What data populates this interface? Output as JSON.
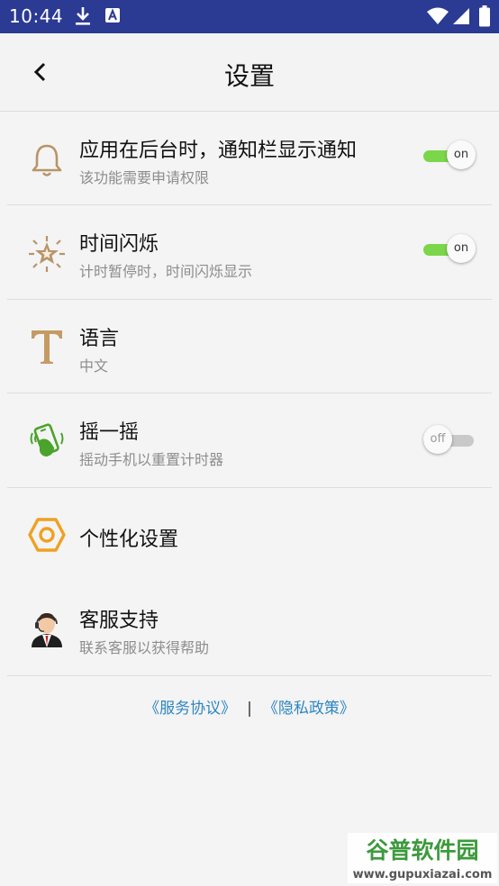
{
  "status_bar": {
    "time": "10:44",
    "icons": [
      "download-icon",
      "text-a-icon",
      "wifi-icon",
      "signal-icon",
      "battery-icon"
    ]
  },
  "header": {
    "title": "设置",
    "back_icon": "chevron-left-icon"
  },
  "settings": [
    {
      "icon": "bell-icon",
      "label": "应用在后台时，通知栏显示通知",
      "sub": "该功能需要申请权限",
      "toggle": "on",
      "toggle_label": "on"
    },
    {
      "icon": "star-flash-icon",
      "label": "时间闪烁",
      "sub": "计时暂停时，时间闪烁显示",
      "toggle": "on",
      "toggle_label": "on"
    },
    {
      "icon": "letter-t-icon",
      "label": "语言",
      "sub": "中文"
    },
    {
      "icon": "shake-phone-icon",
      "label": "摇一摇",
      "sub": "摇动手机以重置计时器",
      "toggle": "off",
      "toggle_label": "off"
    },
    {
      "icon": "hexagon-settings-icon",
      "label": "个性化设置"
    },
    {
      "icon": "customer-service-icon",
      "label": "客服支持",
      "sub": "联系客服以获得帮助"
    }
  ],
  "footer": {
    "service_agreement": "《服务协议》",
    "separator": "|",
    "privacy_policy": "《隐私政策》"
  },
  "watermark": {
    "brand": "谷普软件园",
    "url": "www.gupuxiazai.com"
  },
  "colors": {
    "status_bar": "#2b3a92",
    "toggle_on": "#7bd64a",
    "toggle_off": "#c9c9c9",
    "link": "#2e86c1",
    "icon_brown": "#b89468",
    "icon_orange": "#f0a020",
    "icon_green": "#4aa32a"
  }
}
